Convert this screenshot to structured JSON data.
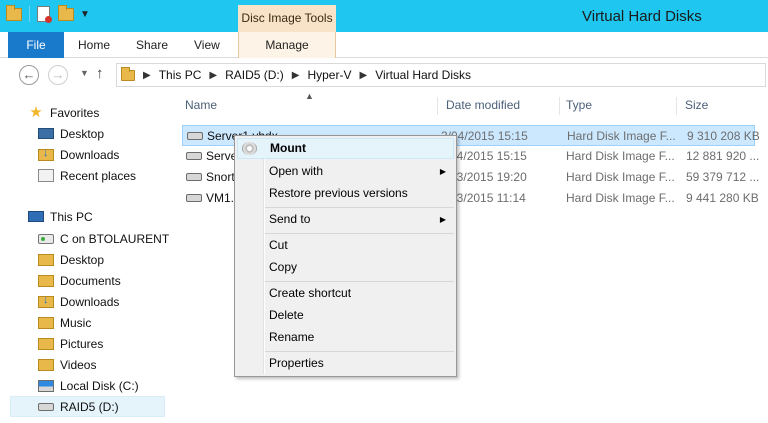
{
  "window": {
    "title": "Virtual Hard Disks",
    "contextual_tab_group": "Disc Image Tools"
  },
  "ribbon": {
    "tabs": [
      {
        "label": "File"
      },
      {
        "label": "Home"
      },
      {
        "label": "Share"
      },
      {
        "label": "View"
      },
      {
        "label": "Manage"
      }
    ]
  },
  "address": {
    "breadcrumbs": [
      "This PC",
      "RAID5 (D:)",
      "Hyper-V",
      "Virtual Hard Disks"
    ]
  },
  "navigation": {
    "favorites": {
      "label": "Favorites",
      "items": [
        {
          "label": "Desktop",
          "icon": "desktop-icon"
        },
        {
          "label": "Downloads",
          "icon": "downloads-folder-icon"
        },
        {
          "label": "Recent places",
          "icon": "recent-places-icon"
        }
      ]
    },
    "this_pc": {
      "label": "This PC",
      "items": [
        {
          "label": "C on BTOLAURENT",
          "icon": "network-drive-icon"
        },
        {
          "label": "Desktop",
          "icon": "folder-icon"
        },
        {
          "label": "Documents",
          "icon": "folder-icon"
        },
        {
          "label": "Downloads",
          "icon": "downloads-folder-icon"
        },
        {
          "label": "Music",
          "icon": "folder-icon"
        },
        {
          "label": "Pictures",
          "icon": "folder-icon"
        },
        {
          "label": "Videos",
          "icon": "folder-icon"
        },
        {
          "label": "Local Disk (C:)",
          "icon": "system-drive-icon"
        },
        {
          "label": "RAID5 (D:)",
          "icon": "drive-icon",
          "selected": true
        }
      ]
    }
  },
  "file_list": {
    "columns": [
      "Name",
      "Date modified",
      "Type",
      "Size"
    ],
    "rows": [
      {
        "name": "Server1.vhdx",
        "date": "3/04/2015 15:15",
        "type": "Hard Disk Image F...",
        "size": "9 310 208 KB",
        "selected": true
      },
      {
        "name": "Serve",
        "date": "3/04/2015 15:15",
        "type": "Hard Disk Image F...",
        "size": "12 881 920 ..."
      },
      {
        "name": "Snort",
        "date": "7/03/2015 19:20",
        "type": "Hard Disk Image F...",
        "size": "59 379 712 ..."
      },
      {
        "name": "VM1.",
        "date": "7/03/2015 11:14",
        "type": "Hard Disk Image F...",
        "size": "9 441 280 KB"
      }
    ]
  },
  "context_menu": {
    "items": {
      "mount": "Mount",
      "open_with": "Open with",
      "restore_previous_versions": "Restore previous versions",
      "send_to": "Send to",
      "cut": "Cut",
      "copy": "Copy",
      "create_shortcut": "Create shortcut",
      "delete": "Delete",
      "rename": "Rename",
      "properties": "Properties"
    }
  },
  "colors": {
    "titlebar": "#1ec6f0",
    "file_tab": "#1979ca",
    "contextual_tab": "#f8e3c8",
    "selection": "#cce8ff",
    "menu_highlight": "#e5f3fb"
  }
}
